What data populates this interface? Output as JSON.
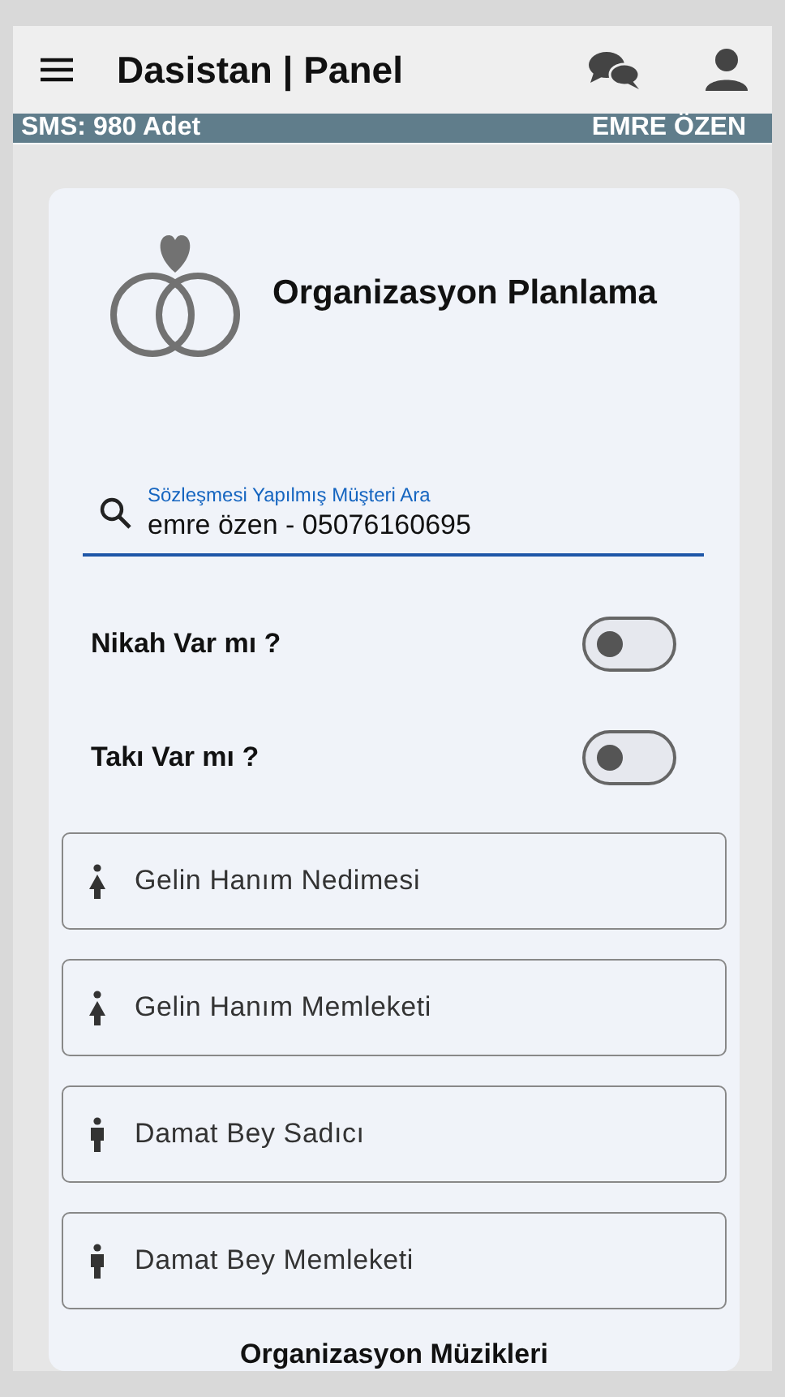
{
  "app_bar": {
    "title": "Dasistan | Panel"
  },
  "info_bar": {
    "sms": "SMS: 980 Adet",
    "user": "EMRE ÖZEN"
  },
  "card": {
    "title": "Organizasyon Planlama",
    "search": {
      "label": "Sözleşmesi Yapılmış Müşteri Ara",
      "value": "emre özen - 05076160695"
    },
    "toggles": [
      {
        "label": "Nikah Var mı ?",
        "on": false
      },
      {
        "label": "Takı Var mı ?",
        "on": false
      }
    ],
    "fields": [
      {
        "kind": "female",
        "placeholder": "Gelin Hanım Nedimesi"
      },
      {
        "kind": "female",
        "placeholder": "Gelin Hanım Memleketi"
      },
      {
        "kind": "male",
        "placeholder": "Damat Bey Sadıcı"
      },
      {
        "kind": "male",
        "placeholder": "Damat Bey Memleketi"
      }
    ],
    "section_title": "Organizasyon Müzikleri"
  }
}
